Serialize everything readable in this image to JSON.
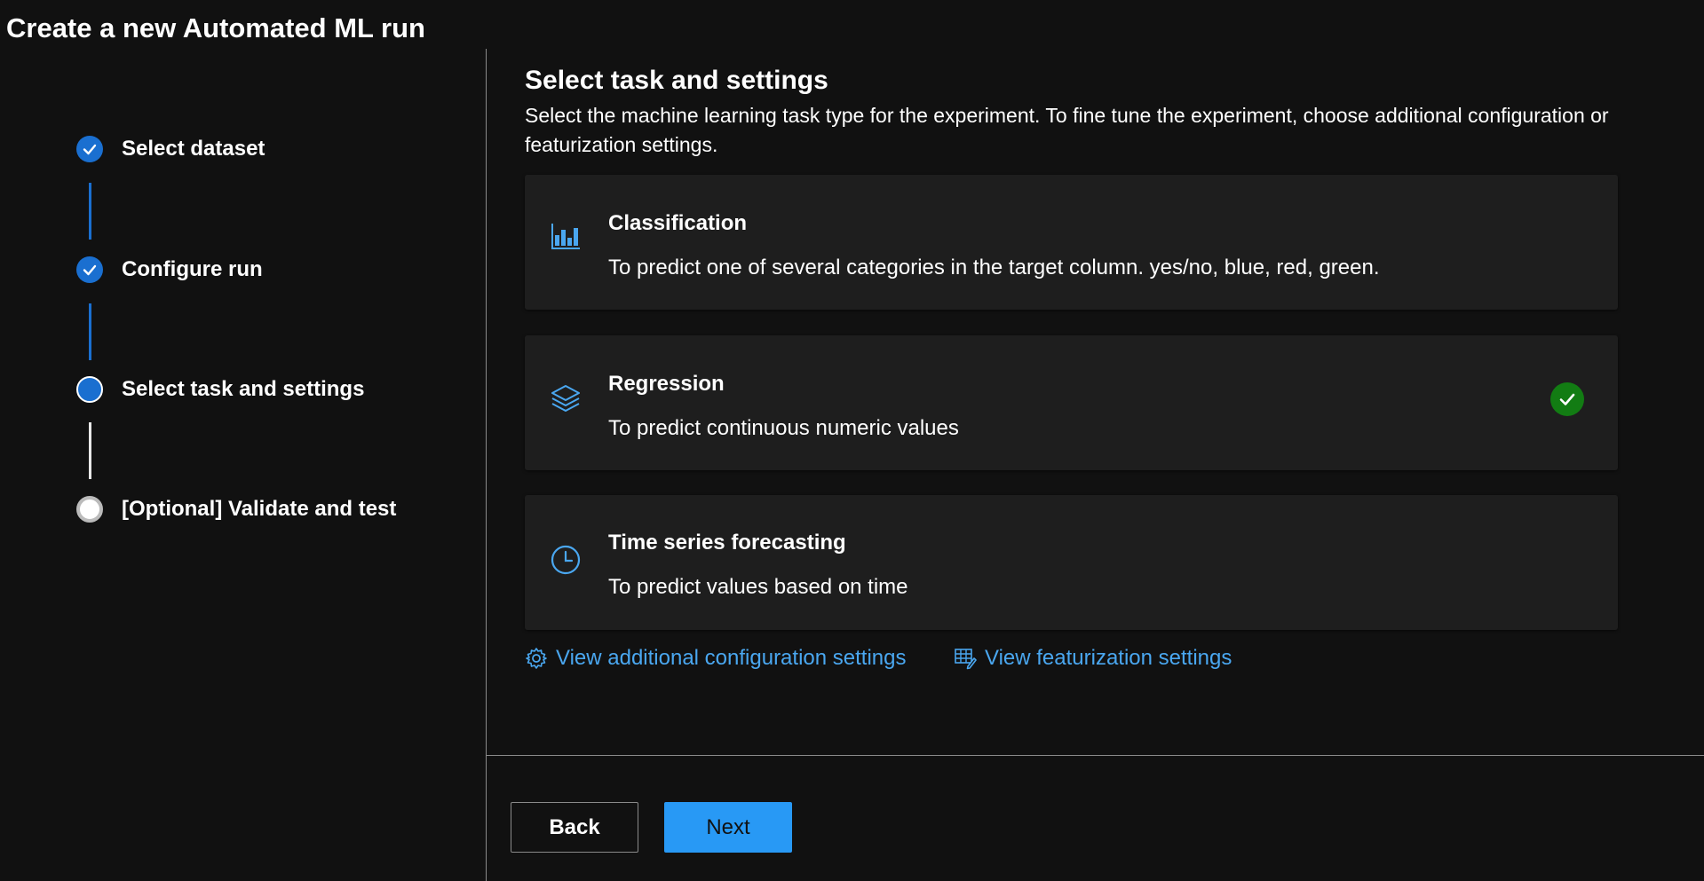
{
  "page": {
    "title": "Create a new Automated ML run"
  },
  "stepper": {
    "steps": [
      {
        "label": "Select dataset",
        "state": "completed"
      },
      {
        "label": "Configure run",
        "state": "completed"
      },
      {
        "label": "Select task and settings",
        "state": "current"
      },
      {
        "label": "[Optional] Validate and test",
        "state": "pending"
      }
    ]
  },
  "main": {
    "title": "Select task and settings",
    "description": "Select the machine learning task type for the experiment. To fine tune the experiment, choose additional configuration or featurization settings.",
    "tasks": [
      {
        "name": "Classification",
        "description": "To predict one of several categories in the target column. yes/no, blue, red, green.",
        "icon": "bar-chart-icon",
        "selected": false
      },
      {
        "name": "Regression",
        "description": "To predict continuous numeric values",
        "icon": "layers-icon",
        "selected": true
      },
      {
        "name": "Time series forecasting",
        "description": "To predict values based on time",
        "icon": "clock-icon",
        "selected": false
      }
    ],
    "links": {
      "config_label": "View additional configuration settings",
      "config_icon": "gear-icon",
      "featurization_label": "View featurization settings",
      "featurization_icon": "table-edit-icon"
    }
  },
  "footer": {
    "back_label": "Back",
    "next_label": "Next"
  },
  "colors": {
    "accent": "#2899f5",
    "step_done": "#1a6fd0",
    "selected_check": "#127c13",
    "link": "#4aa7f0",
    "background": "#111111",
    "card": "#1e1e1e"
  }
}
